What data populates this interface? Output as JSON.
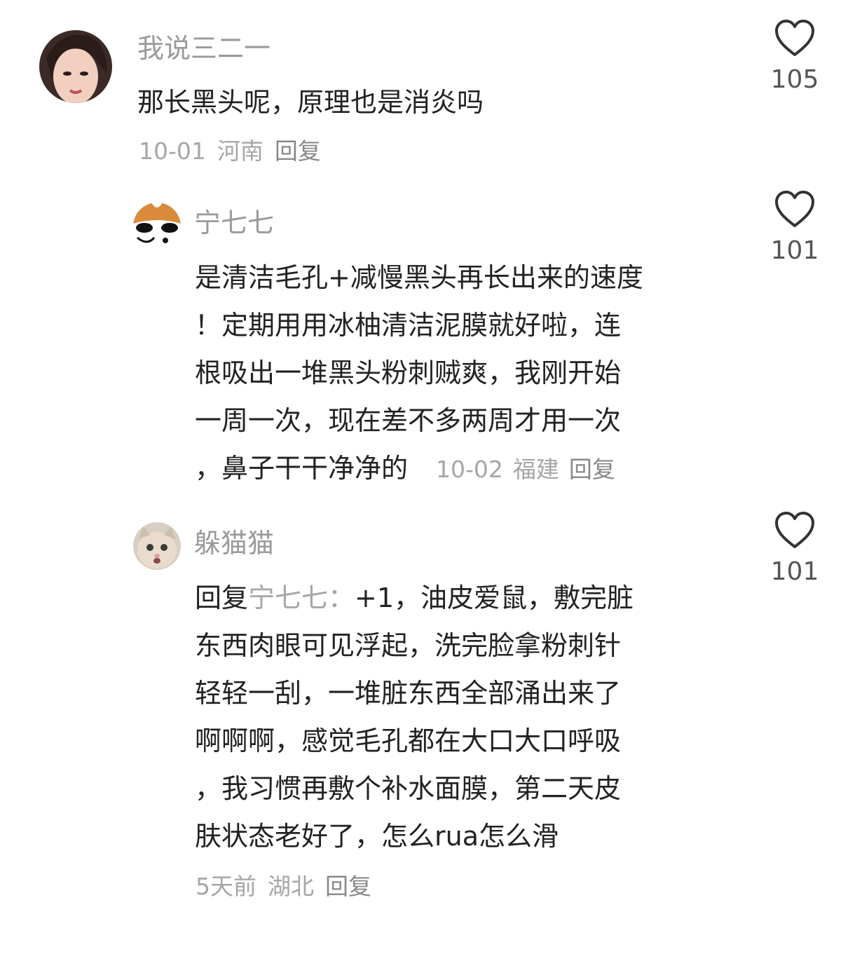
{
  "comments": [
    {
      "username": "我说三二一",
      "text_lines": [
        "那长黑头呢，原理也是消炎吗"
      ],
      "date": "10-01",
      "location": "河南",
      "reply_label": "回复",
      "likes": "105"
    },
    {
      "username": "宁七七",
      "text_lines": [
        "是清洁毛孔+减慢黑头再长出来的速度",
        "！定期用用冰柚清洁泥膜就好啦，连",
        "根吸出一堆黑头粉刺贼爽，我刚开始",
        "一周一次，现在差不多两周才用一次",
        "，鼻子干干净净的"
      ],
      "date": "10-02",
      "location": "福建",
      "reply_label": "回复",
      "likes": "101"
    },
    {
      "username": "躲猫猫",
      "reply_prefix": "回复",
      "reply_target": "宁七七：",
      "text_lines": [
        "+1，油皮爱鼠，敷完脏",
        "东西肉眼可见浮起，洗完脸拿粉刺针",
        "轻轻一刮，一堆脏东西全部涌出来了",
        "啊啊啊，感觉毛孔都在大口大口呼吸",
        "，我习惯再敷个补水面膜，第二天皮",
        "肤状态老好了，怎么rua怎么滑"
      ],
      "date": "5天前",
      "location": "湖北",
      "reply_label": "回复",
      "likes": "101"
    }
  ],
  "icons": {
    "like": "heart-outline-icon"
  },
  "colors": {
    "username": "#9a9a9a",
    "text": "#222222",
    "meta": "#a6a6a6"
  }
}
